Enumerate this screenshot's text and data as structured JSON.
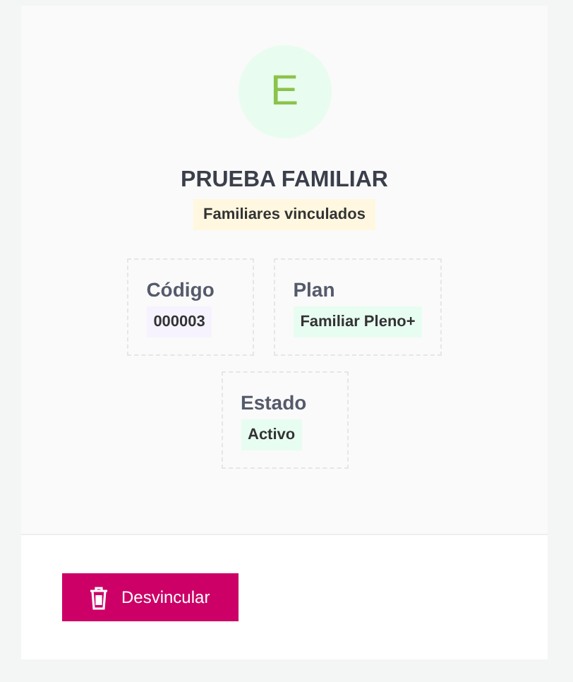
{
  "avatar": {
    "initial": "E"
  },
  "name": "PRUEBA FAMILIAR",
  "tag": "Familiares vinculados",
  "fields": [
    {
      "label": "Código",
      "value": "000003",
      "color": "#f6f3fe"
    },
    {
      "label": "Plan",
      "value": "Familiar Pleno+",
      "color": "#e8fdf2"
    },
    {
      "label": "Estado",
      "value": "Activo",
      "color": "#e8fdf2"
    }
  ],
  "actions": [
    {
      "label": "Desvincular",
      "kind": "delete"
    }
  ]
}
